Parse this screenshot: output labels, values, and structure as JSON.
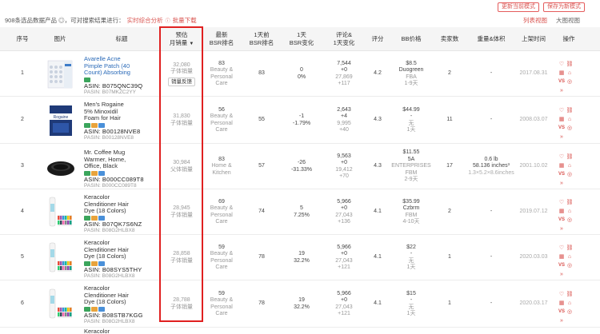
{
  "toolbar": {
    "summary_count": "908条",
    "summary_text": "选品数据产品 ◎，可对搜索结果进行：",
    "link_analysis": "实时综合分析",
    "link_analysis_icon": "info-icon",
    "link_bulk": "批量下载",
    "btn_update": "更新当前模式",
    "btn_save": "保存为新模式",
    "view_list": "列表视图",
    "view_grid": "大图视图"
  },
  "headers": {
    "idx": "序号",
    "img": "图片",
    "title": "标题",
    "sales_1": "预估",
    "sales_2": "月销量",
    "bsr_1": "最新",
    "bsr_2": "BSR排名",
    "bsr1d_1": "1天前",
    "bsr1d_2": "BSR排名",
    "bsrchg_1": "1天",
    "bsrchg_2": "BSR变化",
    "review_1": "评论&",
    "review_2": "1天变化",
    "rating": "评分",
    "price": "BB价格",
    "sellers": "卖家数",
    "weight": "重量&体积",
    "listed": "上架时间",
    "ops": "操作"
  },
  "rows": [
    {
      "idx": "1",
      "title_lines": [
        "Avarelle Acne",
        "Pimple Patch (40",
        "Count) Absorbing"
      ],
      "title_link": true,
      "asin": "ASIN: B075QNC39Q",
      "pasin": "PASIN: B07MKZC2YY",
      "sales": "32,080",
      "sales_sub": "子体销量",
      "sales_btn": "销量反馈",
      "bsr": "83",
      "bsr_cat_1": "Beauty &",
      "bsr_cat_2": "Personal Care",
      "bsr1d": "83",
      "bsrchg_1": "0",
      "bsrchg_2": "0%",
      "rev_1": "7,544",
      "rev_2": "+0",
      "rev_3": "27,869",
      "rev_4": "+117",
      "rating": "4.2",
      "price_1": "$8.5",
      "price_2": "Duogreen",
      "price_3": "FBA",
      "price_4": "1-9天",
      "sellers": "2",
      "weight_1": "-",
      "weight_2": "",
      "weight_3": "",
      "listed": "2017.08.31"
    },
    {
      "idx": "2",
      "title_lines": [
        "Men's Rogaine",
        "5% Minoxidil",
        "Foam for Hair"
      ],
      "title_link": false,
      "asin": "ASIN: B00128NVE8",
      "pasin": "PASIN: B00128NVE8",
      "sales": "31,830",
      "sales_sub": "子体销量",
      "sales_btn": "",
      "bsr": "56",
      "bsr_cat_1": "Beauty &",
      "bsr_cat_2": "Personal Care",
      "bsr1d": "55",
      "bsrchg_1": "-1",
      "bsrchg_2": "-1.79%",
      "rev_1": "2,643",
      "rev_2": "+4",
      "rev_3": "9,995",
      "rev_4": "+40",
      "rating": "4.3",
      "price_1": "$44.99",
      "price_2": "-",
      "price_3": "无",
      "price_4": "1天",
      "sellers": "11",
      "weight_1": "-",
      "weight_2": "",
      "weight_3": "",
      "listed": "2008.03.07"
    },
    {
      "idx": "3",
      "title_lines": [
        "Mr. Coffee Mug",
        "Warmer, Home,",
        "Office, Black"
      ],
      "title_link": false,
      "asin": "ASIN: B000CC089T8",
      "pasin": "PASIN: B000CC089T8",
      "sales": "30,984",
      "sales_sub": "父体销量",
      "sales_btn": "",
      "bsr": "83",
      "bsr_cat_1": "Home &",
      "bsr_cat_2": "Kitchen",
      "bsr1d": "57",
      "bsrchg_1": "-26",
      "bsrchg_2": "-31.33%",
      "rev_1": "9,563",
      "rev_2": "+0",
      "rev_3": "19,412",
      "rev_4": "+70",
      "rating": "4.3",
      "price_1": "$11.55",
      "price_2": "5A",
      "price_3": "ENTERPRISES",
      "price_4": "FBM",
      "price_5": "2-9天",
      "sellers": "17",
      "weight_1": "0.6 lb",
      "weight_2": "58.136 inches³",
      "weight_3": "1.3×5.2×8.6inches",
      "listed": "2001.10.02"
    },
    {
      "idx": "4",
      "title_lines": [
        "Keracolor",
        "Clenditioner Hair",
        "Dye (18 Colors)"
      ],
      "title_link": false,
      "asin": "ASIN: B07QK7S6NZ",
      "pasin": "PASIN: B08G2HLBX8",
      "sales": "28,945",
      "sales_sub": "子体销量",
      "sales_btn": "",
      "bsr": "69",
      "bsr_cat_1": "Beauty &",
      "bsr_cat_2": "Personal Care",
      "bsr1d": "74",
      "bsrchg_1": "5",
      "bsrchg_2": "7.25%",
      "rev_1": "5,966",
      "rev_2": "+0",
      "rev_3": "27,043",
      "rev_4": "+136",
      "rating": "4.1",
      "price_1": "$35.99",
      "price_2": "Czbrm",
      "price_3": "FBM",
      "price_4": "4-10天",
      "sellers": "2",
      "weight_1": "-",
      "weight_2": "",
      "weight_3": "",
      "listed": "2019.07.12"
    },
    {
      "idx": "5",
      "title_lines": [
        "Keracolor",
        "Clenditioner Hair",
        "Dye (18 Colors)"
      ],
      "title_link": false,
      "asin": "ASIN: B08SYS5THY",
      "pasin": "PASIN: B08G2HLBX8",
      "sales": "28,858",
      "sales_sub": "子体销量",
      "sales_btn": "",
      "bsr": "59",
      "bsr_cat_1": "Beauty &",
      "bsr_cat_2": "Personal Care",
      "bsr1d": "78",
      "bsrchg_1": "19",
      "bsrchg_2": "32.2%",
      "rev_1": "5,966",
      "rev_2": "+0",
      "rev_3": "27,043",
      "rev_4": "+121",
      "rating": "4.1",
      "price_1": "$22",
      "price_2": "-",
      "price_3": "无",
      "price_4": "1天",
      "sellers": "1",
      "weight_1": "-",
      "weight_2": "",
      "weight_3": "",
      "listed": "2020.03.03"
    },
    {
      "idx": "6",
      "title_lines": [
        "Keracolor",
        "Clenditioner Hair",
        "Dye (18 Colors)"
      ],
      "title_link": false,
      "asin": "ASIN: B08STB7KGG",
      "pasin": "PASIN: B08G2HLBX8",
      "sales": "28,788",
      "sales_sub": "子体销量",
      "sales_btn": "",
      "bsr": "59",
      "bsr_cat_1": "Beauty &",
      "bsr_cat_2": "Personal Care",
      "bsr1d": "78",
      "bsrchg_1": "19",
      "bsrchg_2": "32.2%",
      "rev_1": "5,966",
      "rev_2": "+0",
      "rev_3": "27,043",
      "rev_4": "+121",
      "rating": "4.1",
      "price_1": "$15",
      "price_2": "-",
      "price_3": "无",
      "price_4": "1天",
      "sellers": "1",
      "weight_1": "-",
      "weight_2": "",
      "weight_3": "",
      "listed": "2020.03.17"
    }
  ],
  "partial_row_title": "Keracolor",
  "tag_colors": [
    "#3ba55c",
    "#e8a33c",
    "#4a90d9"
  ],
  "accent_red": "#d9534f",
  "highlight_color": "#e02020"
}
